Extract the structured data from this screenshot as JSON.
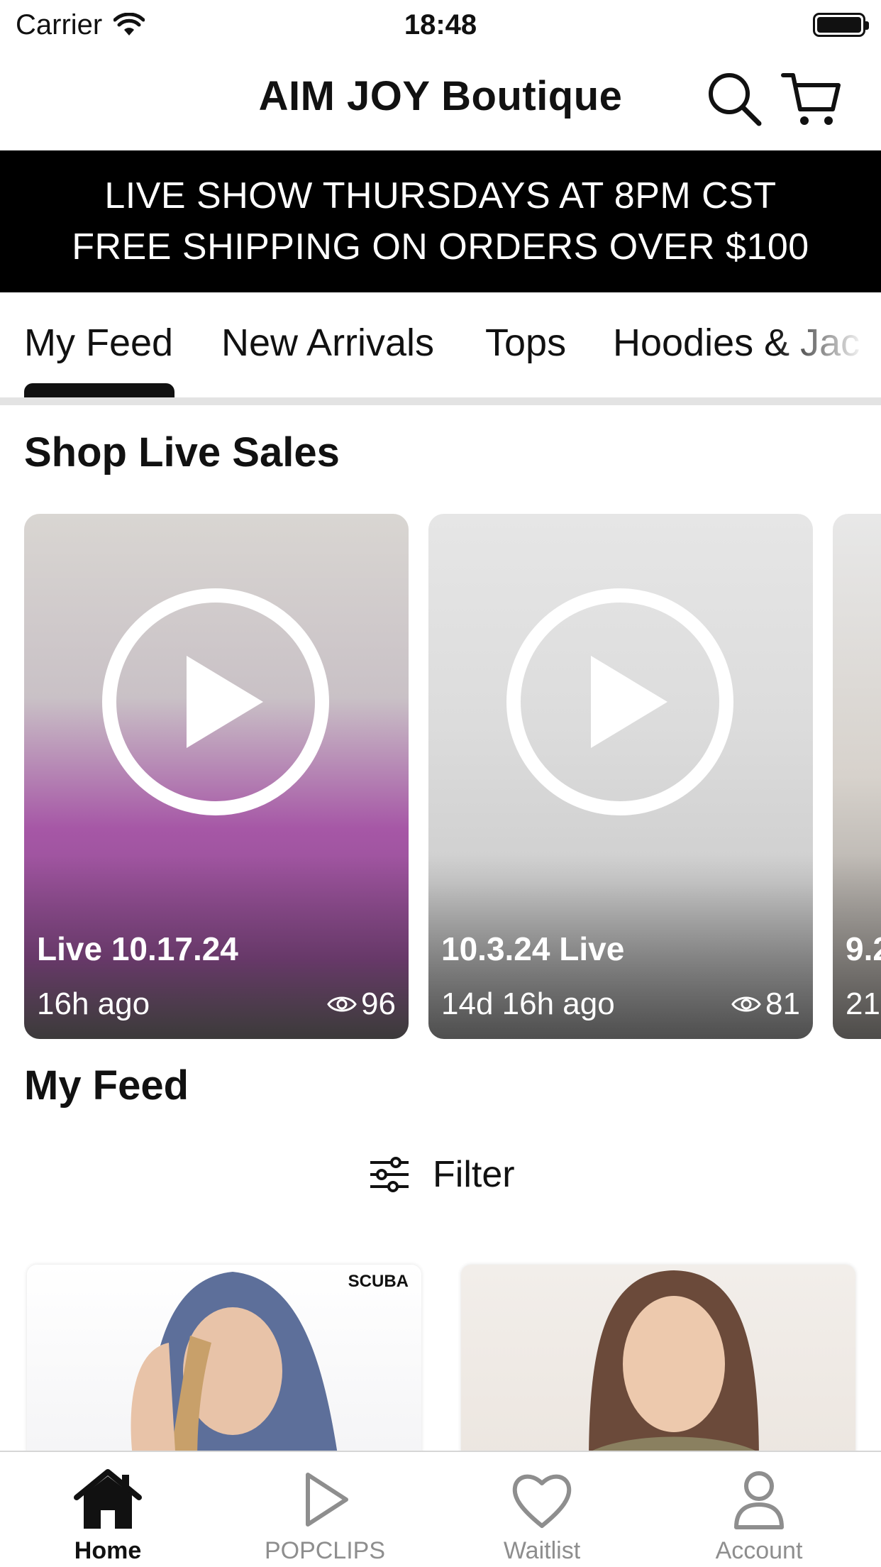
{
  "status_bar": {
    "carrier": "Carrier",
    "time": "18:48"
  },
  "header": {
    "title": "AIM JOY Boutique"
  },
  "promo": {
    "line1": "LIVE SHOW THURSDAYS AT 8PM CST",
    "line2": "FREE SHIPPING ON ORDERS OVER $100"
  },
  "tabs": [
    {
      "label": "My Feed",
      "active": true
    },
    {
      "label": "New Arrivals"
    },
    {
      "label": "Tops"
    },
    {
      "label": "Hoodies & Jac"
    }
  ],
  "sections": {
    "live": "Shop Live Sales",
    "feed": "My Feed"
  },
  "live_sales": [
    {
      "title": "Live 10.17.24",
      "ago": "16h ago",
      "views": "96"
    },
    {
      "title": "10.3.24 Live",
      "ago": "14d 16h ago",
      "views": "81"
    },
    {
      "title": "9.2",
      "ago": "21"
    }
  ],
  "filter": {
    "label": "Filter"
  },
  "products": [
    {
      "tag": "SCUBA"
    },
    {
      "tag": ""
    }
  ],
  "bottom_nav": [
    {
      "label": "Home",
      "icon": "home-icon",
      "active": true
    },
    {
      "label": "POPCLIPS",
      "icon": "play-icon"
    },
    {
      "label": "Waitlist",
      "icon": "heart-icon"
    },
    {
      "label": "Account",
      "icon": "user-icon"
    }
  ],
  "colors": {
    "banner_bg": "#000000",
    "banner_text": "#ffffff",
    "inactive_nav": "#8e8e8e",
    "active": "#111111"
  }
}
